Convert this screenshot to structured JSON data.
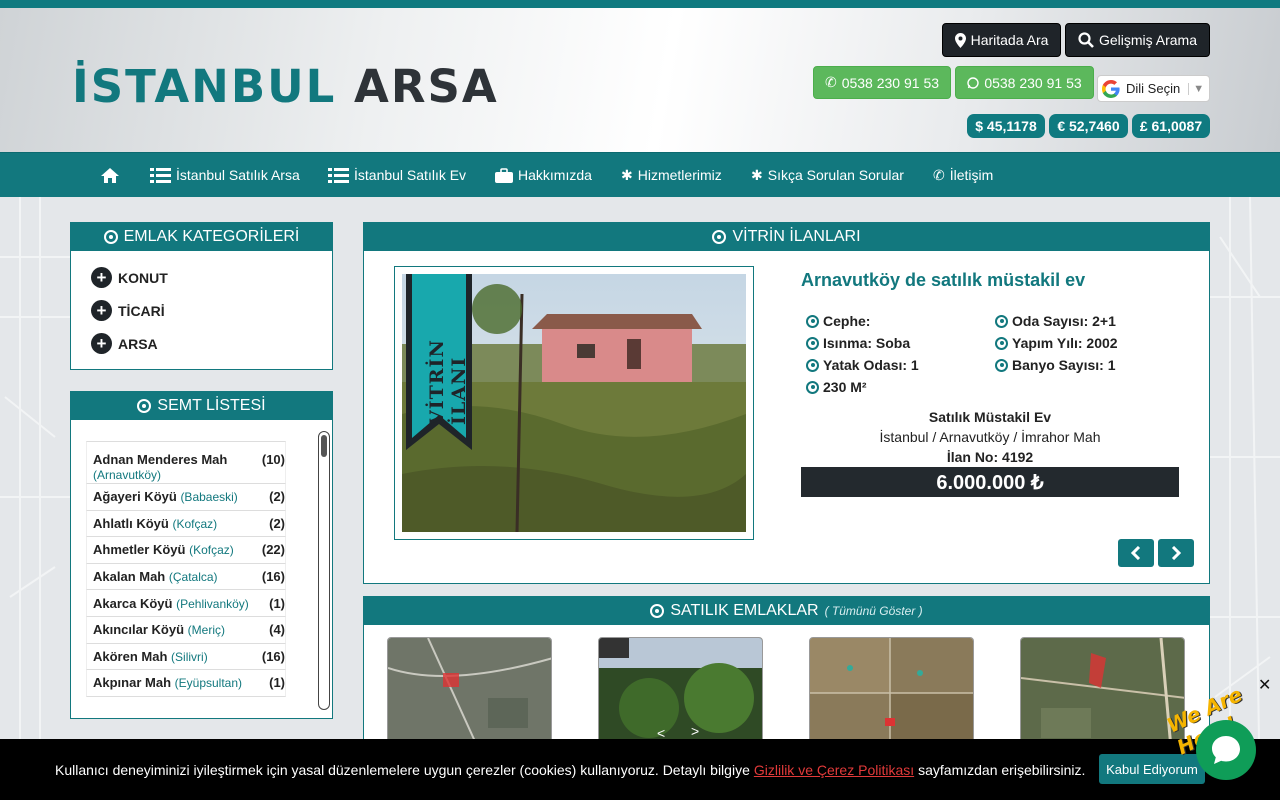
{
  "logo": {
    "part1": "İSTANBUL",
    "part2": "ARSA"
  },
  "header_buttons": {
    "map_search": "Haritada Ara",
    "advanced_search": "Gelişmiş Arama",
    "phone1": "0538 230 91 53",
    "phone2": "0538 230 91 53",
    "language": "Dili Seçin"
  },
  "currency": {
    "usd": "$ 45,1178",
    "eur": "€ 52,7460",
    "gbp": "£ 61,0087"
  },
  "nav": {
    "land": "İstanbul Satılık Arsa",
    "house": "İstanbul Satılık Ev",
    "about": "Hakkımızda",
    "services": "Hizmetlerimiz",
    "faq": "Sıkça Sorulan Sorular",
    "contact": "İletişim"
  },
  "categories": {
    "title": "EMLAK KATEGORİLERİ",
    "items": [
      "KONUT",
      "TİCARİ",
      "ARSA"
    ]
  },
  "semt": {
    "title": "SEMT LİSTESİ",
    "items": [
      {
        "name": "Adnan Menderes Mah",
        "district": "(Arnavutköy)",
        "count": "(10)"
      },
      {
        "name": "Ağayeri Köyü",
        "district": "(Babaeski)",
        "count": "(2)"
      },
      {
        "name": "Ahlatlı Köyü",
        "district": "(Kofçaz)",
        "count": "(2)"
      },
      {
        "name": "Ahmetler Köyü",
        "district": "(Kofçaz)",
        "count": "(22)"
      },
      {
        "name": "Akalan Mah",
        "district": "(Çatalca)",
        "count": "(16)"
      },
      {
        "name": "Akarca Köyü",
        "district": "(Pehlivanköy)",
        "count": "(1)"
      },
      {
        "name": "Akıncılar Köyü",
        "district": "(Meriç)",
        "count": "(4)"
      },
      {
        "name": "Akören Mah",
        "district": "(Silivri)",
        "count": "(16)"
      },
      {
        "name": "Akpınar Mah",
        "district": "(Eyüpsultan)",
        "count": "(1)"
      }
    ]
  },
  "showcase": {
    "title": "VİTRİN İLANLARI",
    "ribbon": "VİTRİN İLANI",
    "listing_title": "Arnavutköy de satılık müstakil ev",
    "features": {
      "facade": "Cephe:",
      "rooms": "Oda Sayısı: 2+1",
      "heating": "Isınma: Soba",
      "year": "Yapım Yılı: 2002",
      "bedrooms": "Yatak Odası: 1",
      "bathrooms": "Banyo Sayısı: 1",
      "area": "230 M²"
    },
    "type": "Satılık Müstakil Ev",
    "location": "İstanbul / Arnavutköy / İmrahor Mah",
    "ilan_no": "İlan No: 4192",
    "price": "6.000.000 ₺"
  },
  "sale": {
    "title": "SATILIK EMLAKLAR",
    "show_all": "( Tümünü Göster )"
  },
  "cookie": {
    "text1": "Kullanıcı deneyiminizi iyileştirmek için yasal düzenlemelere uygun çerezler (cookies) kullanıyoruz. Detaylı bilgiye",
    "link": "Gizlilik ve Çerez Politikası",
    "text2": "sayfamızdan erişebilirsiniz.",
    "accept": "Kabul Ediyorum"
  },
  "chat": {
    "badge": "We Are Here!",
    "close": "✕"
  },
  "colors": {
    "primary": "#12787e",
    "dark": "#1f2429",
    "green": "#5cb85c"
  }
}
